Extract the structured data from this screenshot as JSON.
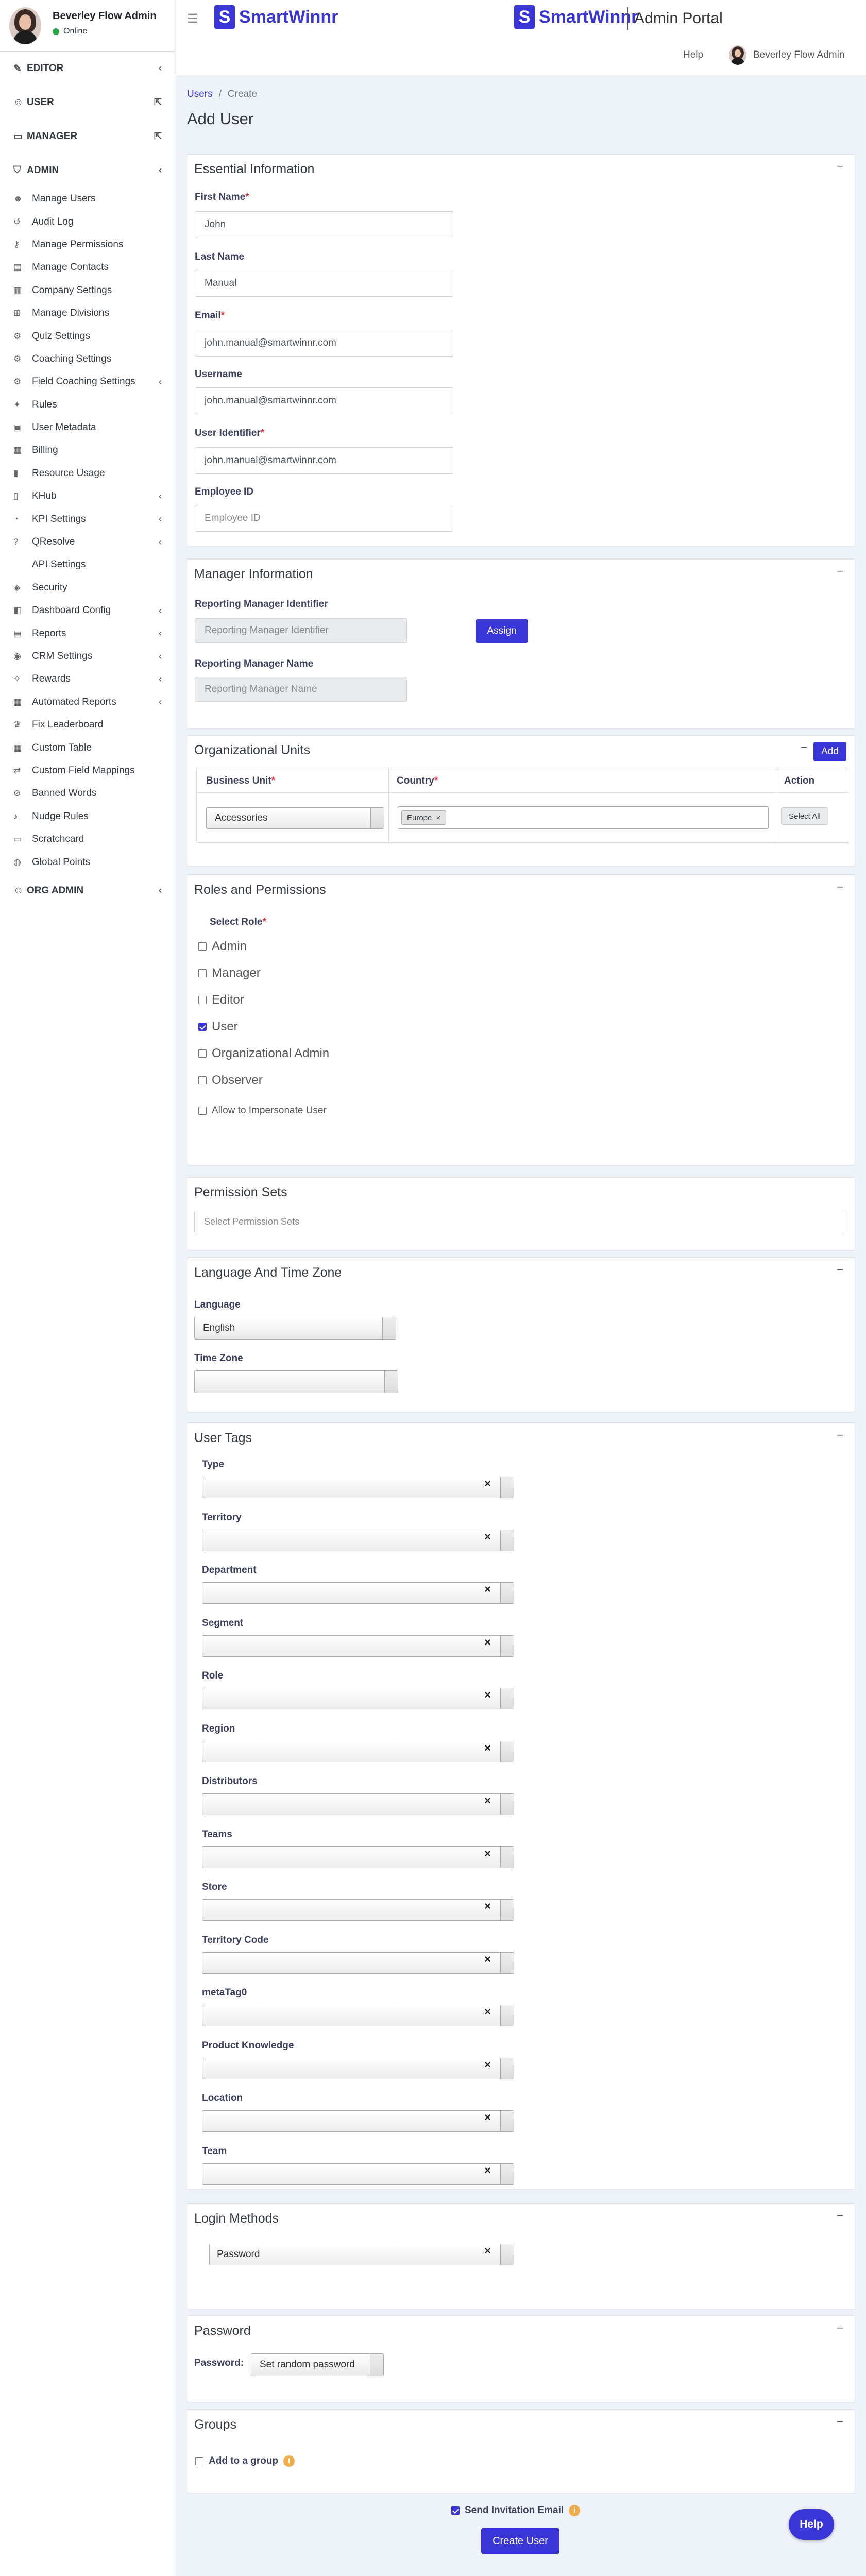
{
  "user": {
    "name": "Beverley Flow Admin",
    "status": "Online"
  },
  "sidebar": {
    "sections_top": [
      {
        "label": "EDITOR",
        "icon": "pencil-icon",
        "right": "‹"
      },
      {
        "label": "USER",
        "icon": "user-icon",
        "right": "⇱"
      },
      {
        "label": "MANAGER",
        "icon": "briefcase-icon",
        "right": "⇱"
      },
      {
        "label": "ADMIN",
        "icon": "shield-icon",
        "right": "‹"
      }
    ],
    "admin_items": [
      {
        "label": "Manage Users",
        "icon": "users-icon",
        "right": ""
      },
      {
        "label": "Audit Log",
        "icon": "history-icon",
        "right": ""
      },
      {
        "label": "Manage Permissions",
        "icon": "key-icon",
        "right": ""
      },
      {
        "label": "Manage Contacts",
        "icon": "contacts-icon",
        "right": ""
      },
      {
        "label": "Company Settings",
        "icon": "building-icon",
        "right": ""
      },
      {
        "label": "Manage Divisions",
        "icon": "sitemap-icon",
        "right": ""
      },
      {
        "label": "Quiz Settings",
        "icon": "gear-icon",
        "right": ""
      },
      {
        "label": "Coaching Settings",
        "icon": "gear-icon",
        "right": ""
      },
      {
        "label": "Field Coaching Settings",
        "icon": "gear-icon",
        "right": "‹"
      },
      {
        "label": "Rules",
        "icon": "wrench-icon",
        "right": ""
      },
      {
        "label": "User Metadata",
        "icon": "id-card-icon",
        "right": ""
      },
      {
        "label": "Billing",
        "icon": "invoice-icon",
        "right": ""
      },
      {
        "label": "Resource Usage",
        "icon": "chart-icon",
        "right": ""
      },
      {
        "label": "KHub",
        "icon": "book-icon",
        "right": "‹"
      },
      {
        "label": "KPI Settings",
        "icon": "kpi-icon",
        "right": "‹"
      },
      {
        "label": "QResolve",
        "icon": "question-icon",
        "right": "‹"
      },
      {
        "label": "API Settings",
        "icon": "code-icon",
        "right": ""
      },
      {
        "label": "Security",
        "icon": "lock-icon",
        "right": ""
      },
      {
        "label": "Dashboard Config",
        "icon": "dashboard-icon",
        "right": "‹"
      },
      {
        "label": "Reports",
        "icon": "report-icon",
        "right": "‹"
      },
      {
        "label": "CRM Settings",
        "icon": "crm-icon",
        "right": "‹"
      },
      {
        "label": "Rewards",
        "icon": "gift-icon",
        "right": "‹"
      },
      {
        "label": "Automated Reports",
        "icon": "calendar-icon",
        "right": "‹"
      },
      {
        "label": "Fix Leaderboard",
        "icon": "trophy-icon",
        "right": ""
      },
      {
        "label": "Custom Table",
        "icon": "table-icon",
        "right": ""
      },
      {
        "label": "Custom Field Mappings",
        "icon": "mapping-icon",
        "right": ""
      },
      {
        "label": "Banned Words",
        "icon": "ban-icon",
        "right": ""
      },
      {
        "label": "Nudge Rules",
        "icon": "bell-icon",
        "right": ""
      },
      {
        "label": "Scratchcard",
        "icon": "card-icon",
        "right": ""
      },
      {
        "label": "Global Points",
        "icon": "globe-icon",
        "right": ""
      }
    ],
    "org_admin": {
      "label": "ORG ADMIN",
      "icon": "user-icon",
      "right": "‹"
    }
  },
  "header": {
    "brand": "SmartWinnr",
    "brand_mark": "S",
    "portal": "Admin Portal",
    "help": "Help",
    "user": "Beverley Flow Admin"
  },
  "breadcrumb": {
    "first": "Users",
    "sep": "/",
    "second": "Create"
  },
  "page_title": "Add User",
  "essential": {
    "title": "Essential Information",
    "first_name": {
      "label": "First Name",
      "value": "John"
    },
    "last_name": {
      "label": "Last Name",
      "value": "Manual"
    },
    "email": {
      "label": "Email",
      "value": "john.manual@smartwinnr.com"
    },
    "username": {
      "label": "Username",
      "value": "john.manual@smartwinnr.com"
    },
    "identifier": {
      "label": "User Identifier",
      "value": "john.manual@smartwinnr.com"
    },
    "employee_id": {
      "label": "Employee ID",
      "placeholder": "Employee ID"
    }
  },
  "manager": {
    "title": "Manager Information",
    "rm_id_label": "Reporting Manager Identifier",
    "rm_id_placeholder": "Reporting Manager Identifier",
    "assign": "Assign",
    "rm_name_label": "Reporting Manager Name",
    "rm_name_placeholder": "Reporting Manager Name"
  },
  "org_units": {
    "title": "Organizational Units",
    "add": "Add",
    "col_bu": "Business Unit",
    "col_country": "Country",
    "col_action": "Action",
    "bu_value": "Accessories",
    "country_tag": "Europe",
    "select_all": "Select All"
  },
  "roles": {
    "title": "Roles and Permissions",
    "select_label": "Select Role",
    "items": [
      {
        "label": "Admin",
        "checked": false
      },
      {
        "label": "Manager",
        "checked": false
      },
      {
        "label": "Editor",
        "checked": false
      },
      {
        "label": "User",
        "checked": true
      },
      {
        "label": "Organizational Admin",
        "checked": false
      },
      {
        "label": "Observer",
        "checked": false
      }
    ],
    "impersonate": "Allow to Impersonate User"
  },
  "permission_sets": {
    "title": "Permission Sets",
    "placeholder": "Select Permission Sets"
  },
  "language": {
    "title": "Language And Time Zone",
    "lang_label": "Language",
    "lang_value": "English",
    "tz_label": "Time Zone"
  },
  "tags": {
    "title": "User Tags",
    "labels": [
      "Type",
      "Territory",
      "Department",
      "Segment",
      "Role",
      "Region",
      "Distributors",
      "Teams",
      "Store",
      "Territory Code",
      "metaTag0",
      "Product Knowledge",
      "Location",
      "Team"
    ],
    "clear": "×"
  },
  "login": {
    "title": "Login Methods",
    "value": "Password"
  },
  "password": {
    "title": "Password",
    "label": "Password:",
    "value": "Set random password"
  },
  "groups": {
    "title": "Groups",
    "add_label": "Add to a group"
  },
  "footer": {
    "send_invite": "Send Invitation Email",
    "create": "Create User",
    "info": "i"
  },
  "collapse_symbol": "−",
  "help_fab": "Help",
  "colors": {
    "primary": "#3a35d6",
    "online": "#28a745",
    "required": "#dc3545",
    "info": "#f0ad4e",
    "background": "#eef2f9"
  }
}
